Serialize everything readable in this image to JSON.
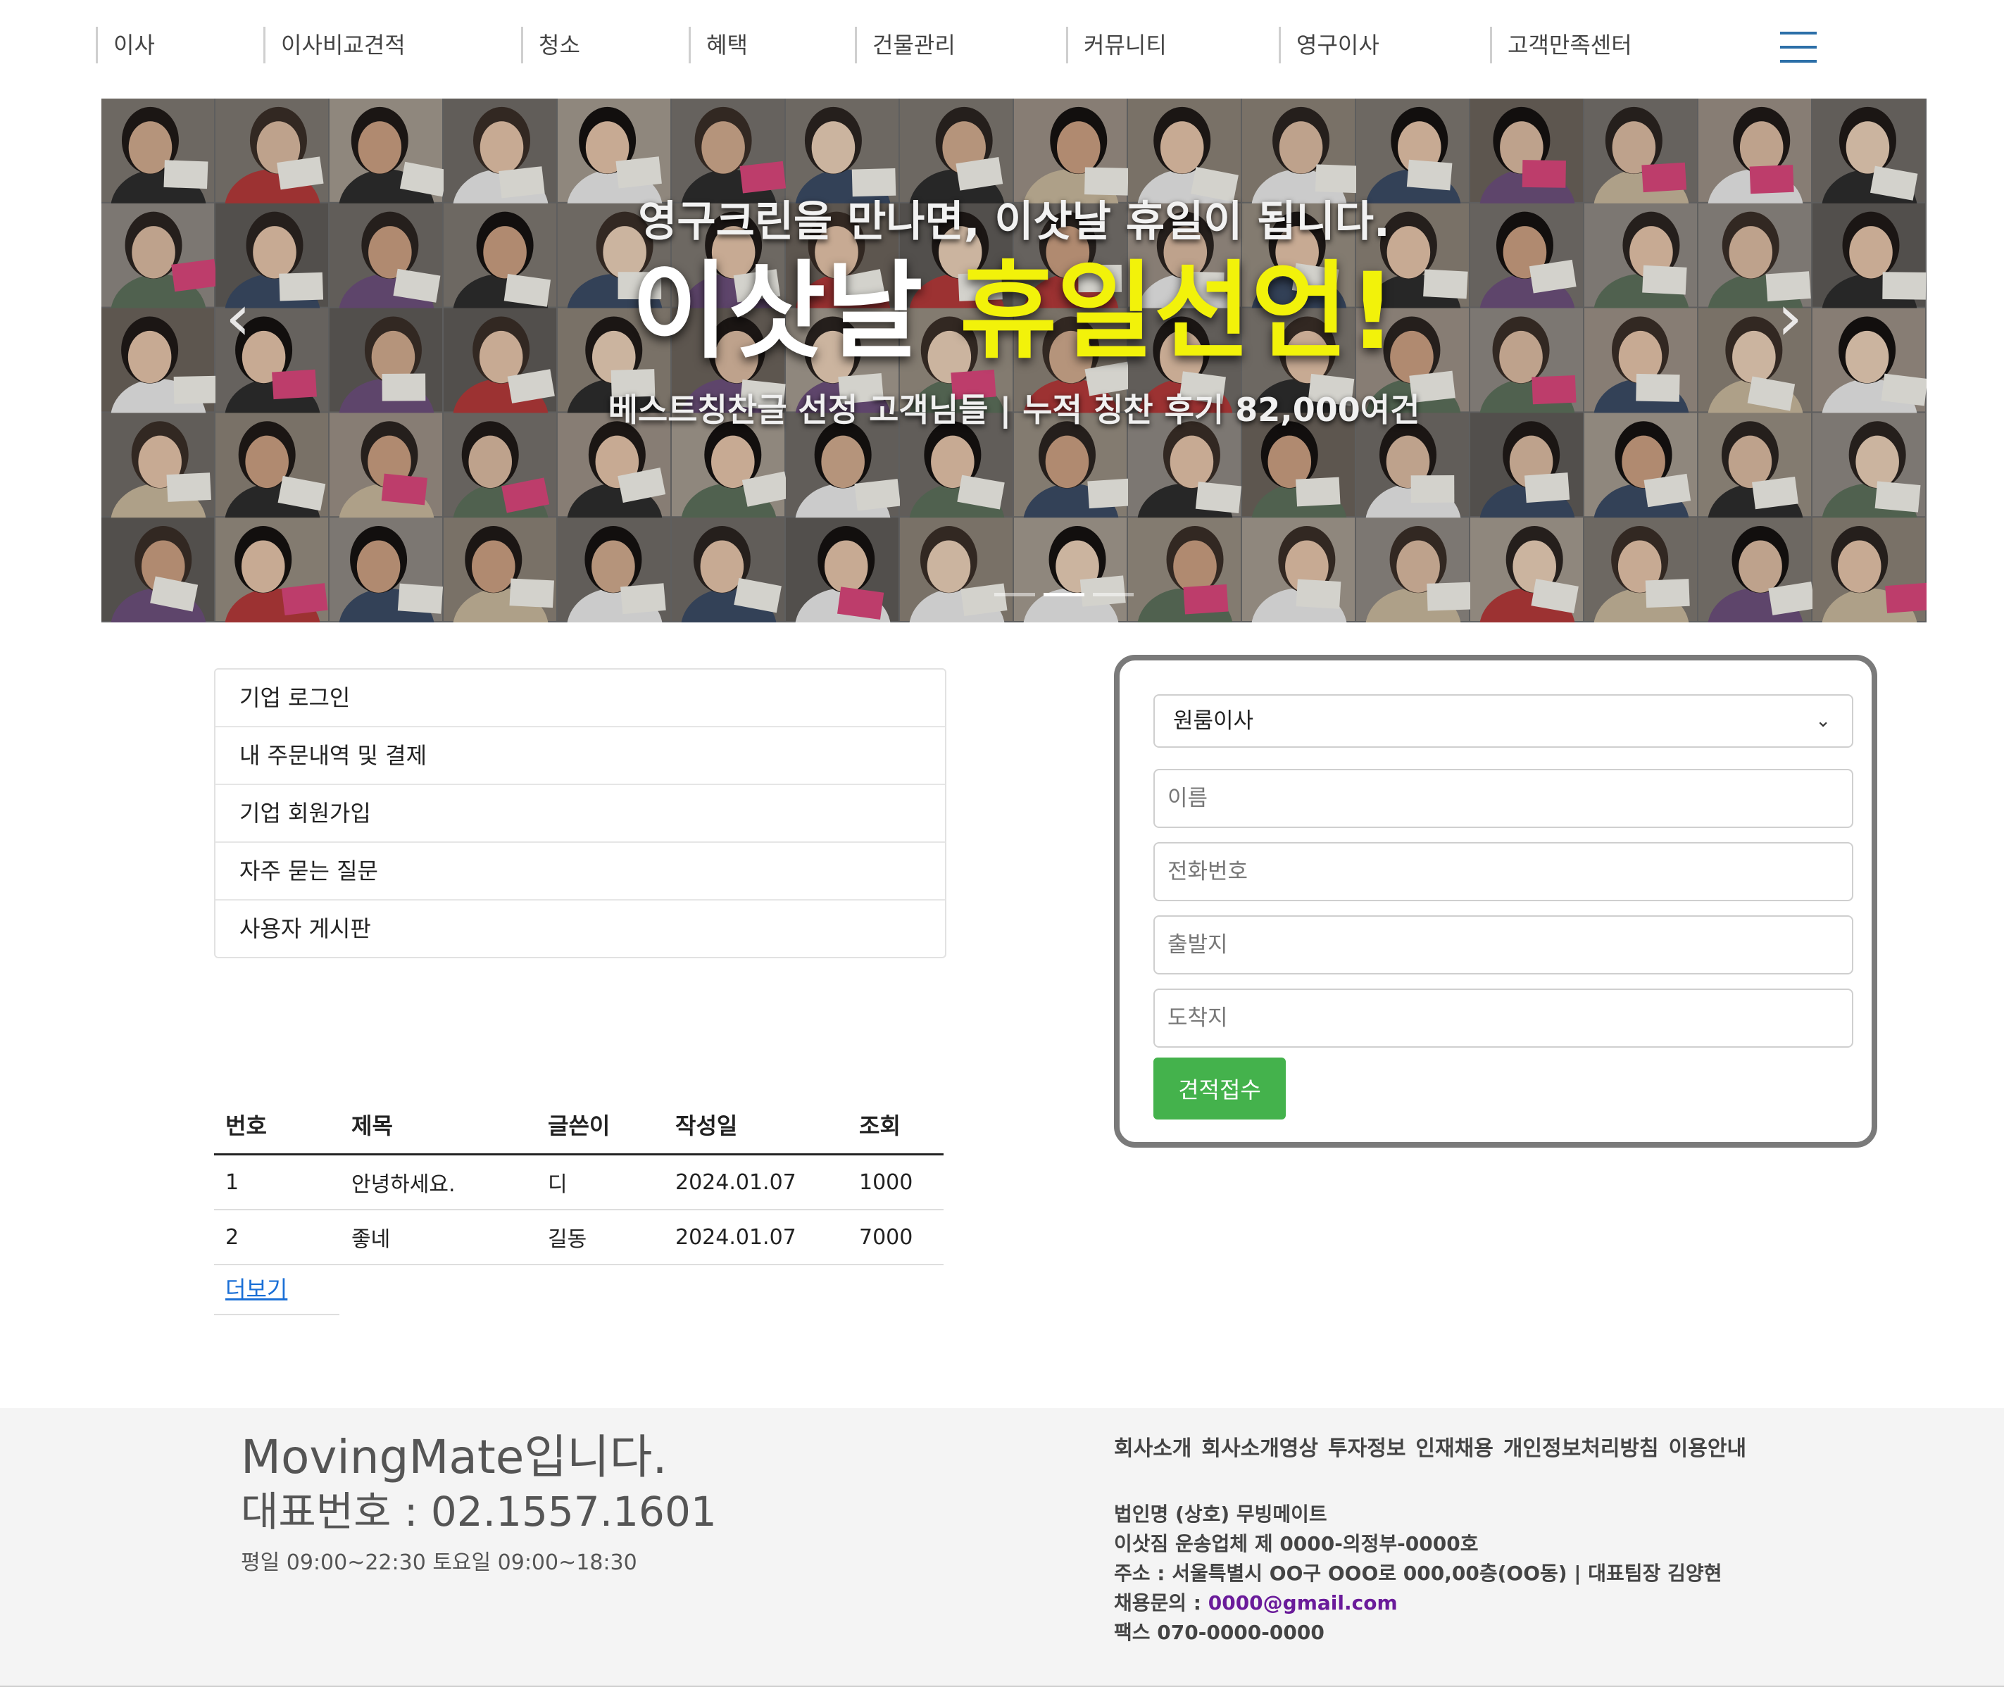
{
  "nav": {
    "items": [
      {
        "label": "이사"
      },
      {
        "label": "이사비교견적"
      },
      {
        "label": "청소"
      },
      {
        "label": "혜택"
      },
      {
        "label": "건물관리"
      },
      {
        "label": "커뮤니티"
      },
      {
        "label": "영구이사"
      },
      {
        "label": "고객만족센터"
      }
    ]
  },
  "hero": {
    "line1": "영구크린을 만나면, 이삿날 휴일이 됩니다.",
    "line2_white": "이삿날 ",
    "line2_yellow": "휴일선언!",
    "line3": "베스트칭찬글 선정 고객님들 | 누적 칭찬 후기 82,000여건",
    "slide_count": 3,
    "active_slide": 1
  },
  "links": [
    {
      "label": "기업 로그인"
    },
    {
      "label": "내 주문내역 및 결제"
    },
    {
      "label": "기업 회원가입"
    },
    {
      "label": "자주 묻는 질문"
    },
    {
      "label": "사용자 게시판"
    }
  ],
  "board": {
    "headers": [
      "번호",
      "제목",
      "글쓴이",
      "작성일",
      "조회"
    ],
    "rows": [
      [
        "1",
        "안녕하세요.",
        "디",
        "2024.01.07",
        "1000"
      ],
      [
        "2",
        "좋네",
        "길동",
        "2024.01.07",
        "7000"
      ]
    ],
    "more_label": "더보기"
  },
  "quote": {
    "select_value": "원룸이사",
    "name_placeholder": "이름",
    "phone_placeholder": "전화번호",
    "from_placeholder": "출발지",
    "to_placeholder": "도착지",
    "submit_label": "견적접수",
    "submit_color": "#44b24c"
  },
  "footer": {
    "brand": "MovingMate입니다.",
    "phone": "대표번호 : 02.1557.1601",
    "hours": "평일 09:00~22:30 토요일 09:00~18:30",
    "links": [
      "회사소개",
      "회사소개영상",
      "투자정보",
      "인재채용",
      "개인정보처리방침",
      "이용안내"
    ],
    "corp": "법인명 (상호) 무빙메이트",
    "license": "이삿짐 운송업체 제 0000-의정부-0000호",
    "address": "주소 : 서울특별시 OO구 OOO로 000,00층(OO동) | 대표팀장 김양현",
    "recruit_label": "채용문의 : ",
    "recruit_email": "0000@gmail.com",
    "fax": "팩스 070-0000-0000"
  }
}
